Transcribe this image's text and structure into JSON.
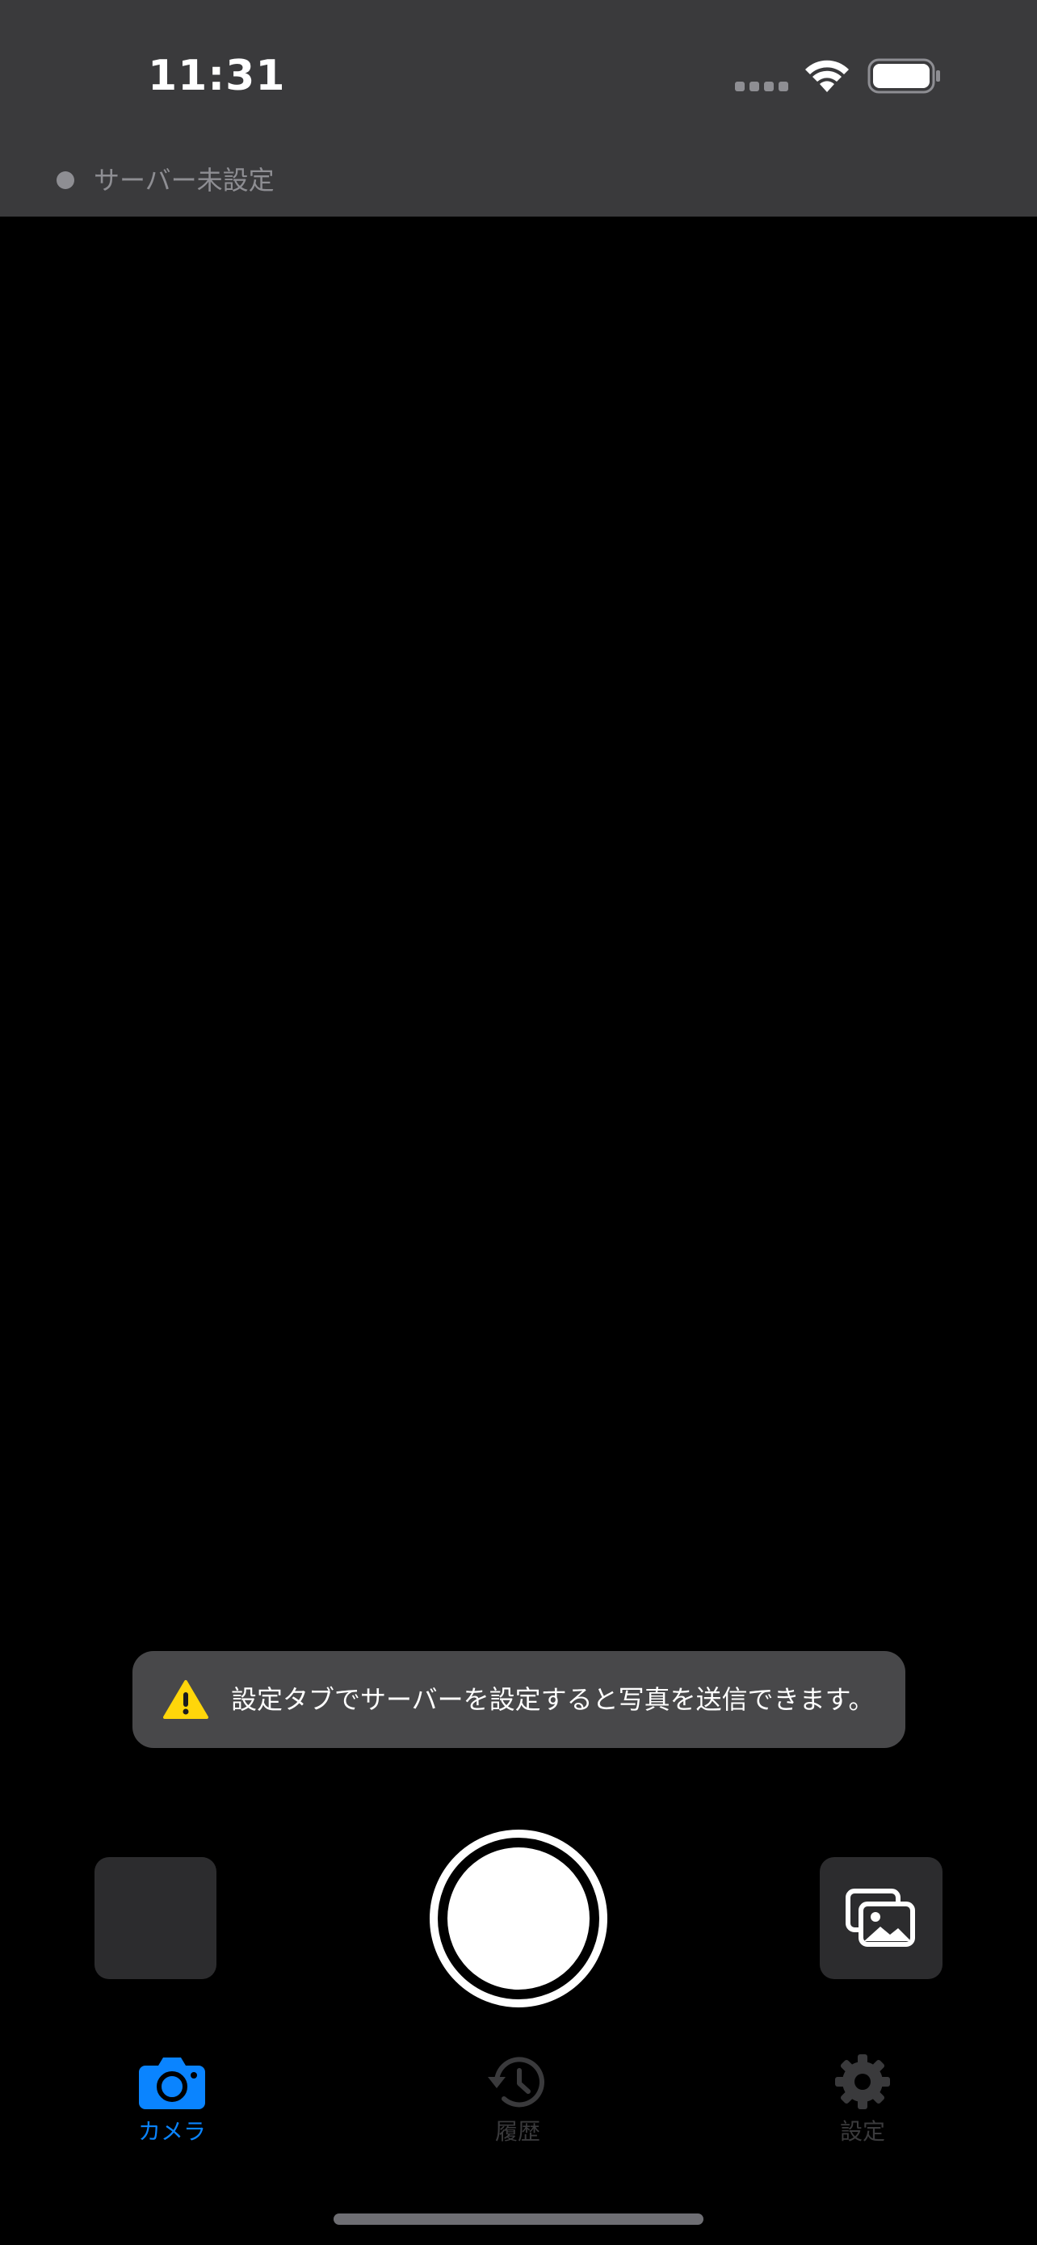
{
  "status_bar": {
    "time": "11:31"
  },
  "header": {
    "server_status": "サーバー未設定"
  },
  "toast": {
    "message": "設定タブでサーバーを設定すると写真を送信できます。",
    "icon": "warning-icon"
  },
  "controls": {
    "thumbnail_icon": "last-photo-thumbnail",
    "shutter_icon": "shutter-button",
    "gallery_icon": "photo-library-icon"
  },
  "tabs": [
    {
      "label": "カメラ",
      "icon": "camera-icon",
      "active": true
    },
    {
      "label": "履歴",
      "icon": "history-icon",
      "active": false
    },
    {
      "label": "設定",
      "icon": "gear-icon",
      "active": false
    }
  ],
  "colors": {
    "header_bg": "#3a3a3c",
    "accent": "#0a84ff",
    "inactive_tab": "#3a3a3c",
    "warning": "#ffd60a",
    "toast_bg": "#48484a"
  }
}
